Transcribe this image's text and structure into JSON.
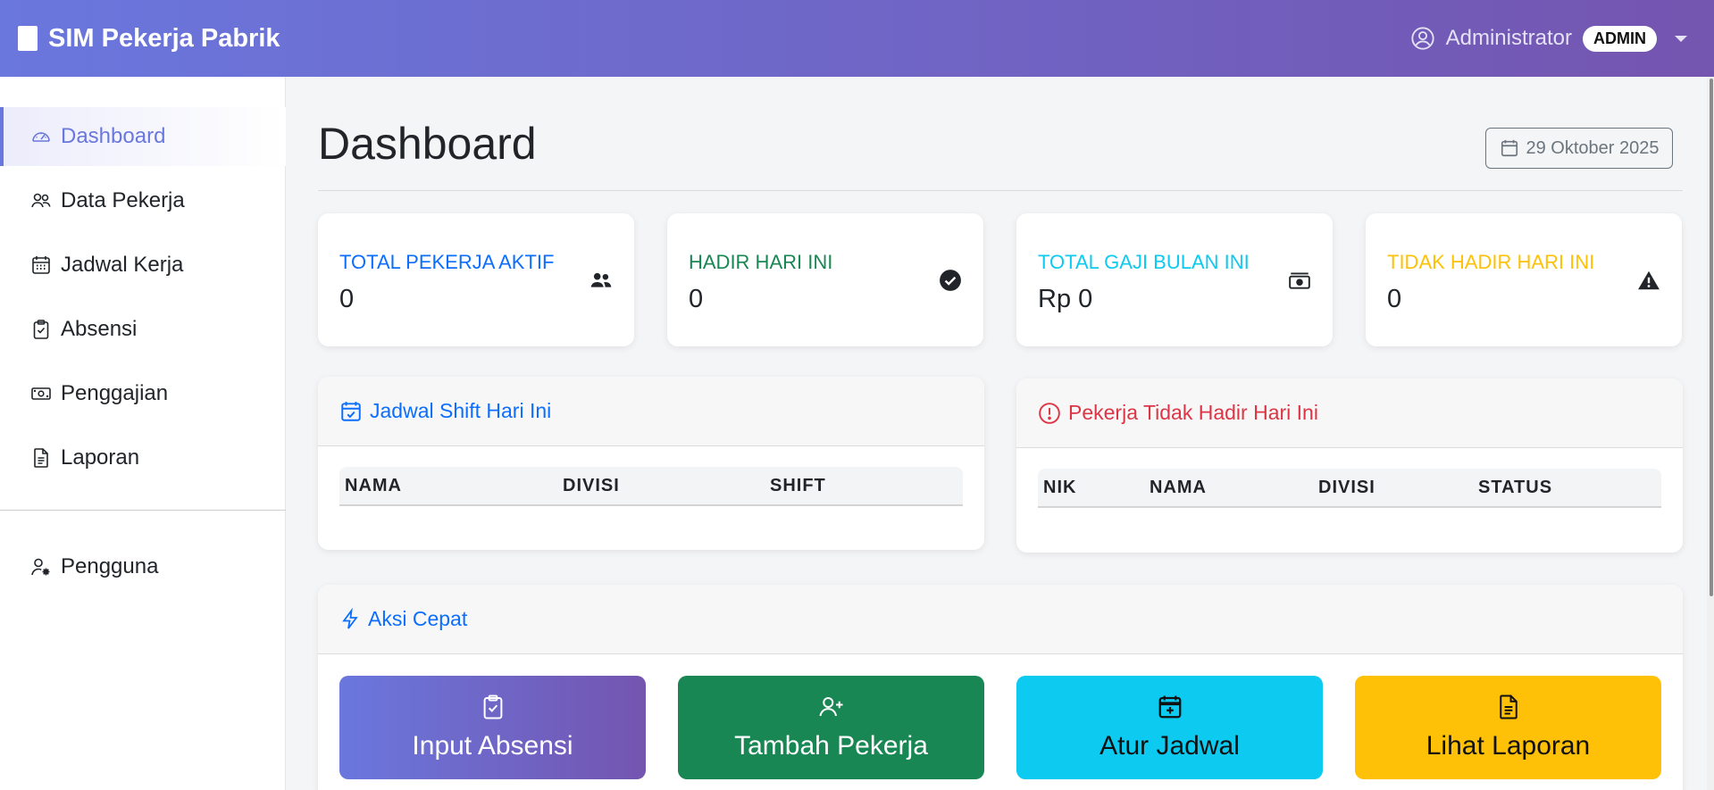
{
  "app": {
    "brand": "SIM Pekerja Pabrik"
  },
  "header": {
    "user_name": "Administrator",
    "role_badge": "ADMIN"
  },
  "sidebar": {
    "items": [
      {
        "label": "Dashboard",
        "icon": "speedometer-icon",
        "active": true
      },
      {
        "label": "Data Pekerja",
        "icon": "people-icon"
      },
      {
        "label": "Jadwal Kerja",
        "icon": "calendar-grid-icon"
      },
      {
        "label": "Absensi",
        "icon": "clipboard-check-icon"
      },
      {
        "label": "Penggajian",
        "icon": "cash-icon"
      },
      {
        "label": "Laporan",
        "icon": "file-text-icon"
      },
      {
        "label": "Pengguna",
        "icon": "person-gear-icon"
      }
    ]
  },
  "page": {
    "title": "Dashboard",
    "date": "29 Oktober 2025"
  },
  "stats": [
    {
      "label": "TOTAL PEKERJA AKTIF",
      "value": "0",
      "color": "#0d6efd",
      "icon": "people-fill-icon"
    },
    {
      "label": "HADIR HARI INI",
      "value": "0",
      "color": "#198754",
      "icon": "check-circle-fill-icon"
    },
    {
      "label": "TOTAL GAJI BULAN INI",
      "value": "Rp 0",
      "color": "#0dcaf0",
      "icon": "cash-stack-icon"
    },
    {
      "label": "TIDAK HADIR HARI INI",
      "value": "0",
      "color": "#ffc107",
      "icon": "warning-triangle-icon"
    }
  ],
  "shift_panel": {
    "title": "Jadwal Shift Hari Ini",
    "columns": [
      "NAMA",
      "DIVISI",
      "SHIFT"
    ]
  },
  "absent_panel": {
    "title": "Pekerja Tidak Hadir Hari Ini",
    "columns": [
      "NIK",
      "NAMA",
      "DIVISI",
      "STATUS"
    ]
  },
  "quick_actions": {
    "title": "Aksi Cepat",
    "buttons": [
      {
        "label": "Input Absensi",
        "icon": "clipboard-check-icon"
      },
      {
        "label": "Tambah Pekerja",
        "icon": "person-plus-icon"
      },
      {
        "label": "Atur Jadwal",
        "icon": "calendar-plus-icon"
      },
      {
        "label": "Lihat Laporan",
        "icon": "file-text-icon"
      }
    ]
  },
  "colors": {
    "primary": "#0d6efd",
    "success": "#198754",
    "info": "#0dcaf0",
    "warning": "#ffc107",
    "danger": "#dc3545",
    "accent": "#6a77dd"
  }
}
